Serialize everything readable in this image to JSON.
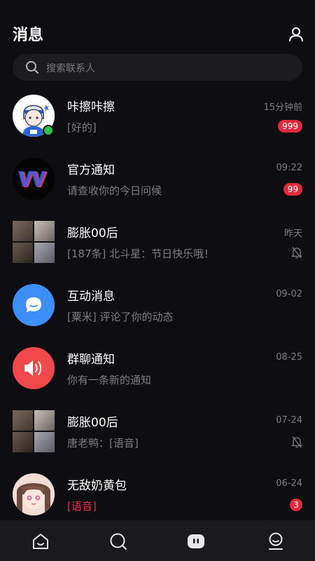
{
  "header": {
    "title": "消息",
    "profile_icon": "person-icon"
  },
  "search": {
    "placeholder": "搜索联系人"
  },
  "colors": {
    "background": "#0e0e12",
    "badge": "#e02a3c",
    "online": "#31c24d",
    "interaction_blue": "#3d8ef7",
    "group_red": "#f0484b"
  },
  "conversations": [
    {
      "name": "咔擦咔擦",
      "message": "[好的]",
      "time": "15分钟前",
      "badge": "999",
      "avatar": "cartoon-boy-avatar",
      "online": true
    },
    {
      "name": "官方通知",
      "message": "请查收你的今日问候",
      "time": "09:22",
      "badge": "99",
      "avatar": "vv-logo-avatar"
    },
    {
      "name": "膨胀00后",
      "message": "[187条] 北斗星：节日快乐哦！",
      "time": "昨天",
      "muted": true,
      "avatar": "group-photo-avatar"
    },
    {
      "name": "互动消息",
      "message": "[粟米] 评论了你的动态",
      "time": "09-02",
      "avatar": "chat-bubble-avatar"
    },
    {
      "name": "群聊通知",
      "message": "你有一条新的通知",
      "time": "08-25",
      "avatar": "speaker-avatar"
    },
    {
      "name": "膨胀00后",
      "message": "唐老鸭：[语音]",
      "time": "07-24",
      "muted": true,
      "avatar": "group-photo-avatar"
    },
    {
      "name": "无敌奶黄包",
      "message": "[语音]",
      "time": "06-24",
      "badge": "3",
      "avatar": "anime-girl-avatar",
      "message_highlight": true
    }
  ],
  "tabbar": {
    "icons": [
      "home-icon",
      "search-icon",
      "message-icon",
      "profile-icon"
    ],
    "active": "message-icon"
  }
}
